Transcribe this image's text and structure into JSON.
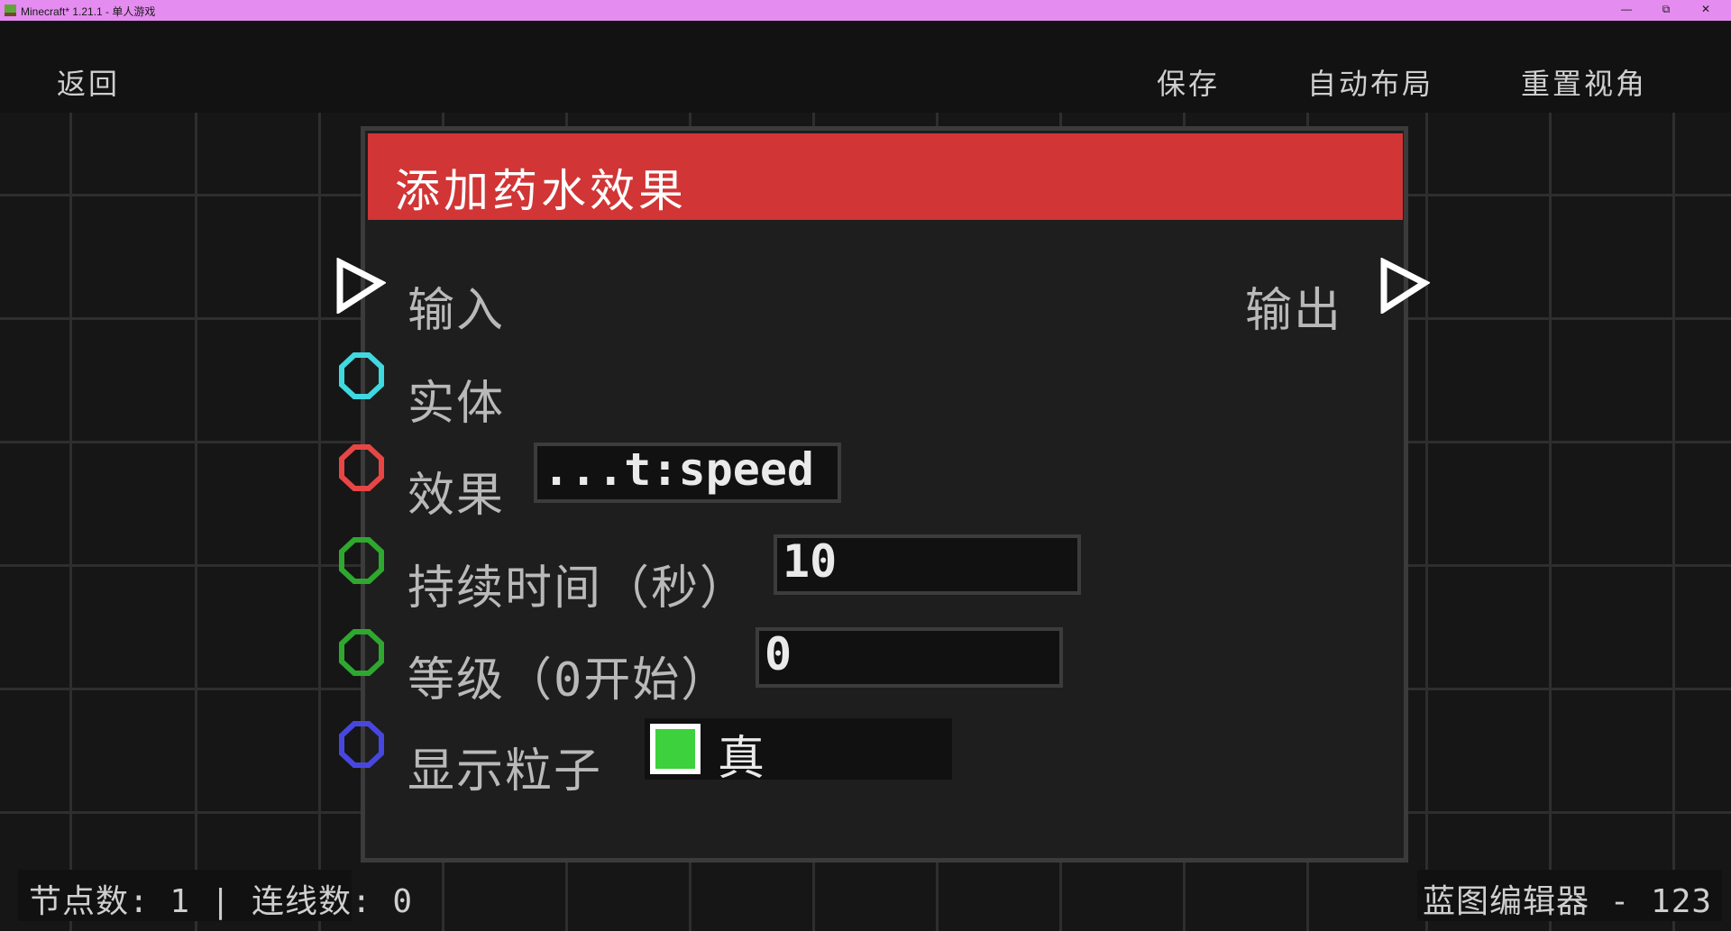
{
  "window": {
    "title": "Minecraft* 1.21.1 - 单人游戏",
    "minimize": "—",
    "maximize": "⧉",
    "close": "✕"
  },
  "menu": {
    "back": "返回",
    "save": "保存",
    "auto_layout": "自动布局",
    "reset_view": "重置视角"
  },
  "node": {
    "title": "添加药水效果",
    "header_color": "#d13535",
    "input_label": "输入",
    "output_label": "输出",
    "pins": [
      {
        "label": "实体",
        "color": "#3fd9e0"
      },
      {
        "label": "效果",
        "color": "#e84545",
        "value": "...t:speed"
      },
      {
        "label": "持续时间（秒）",
        "color": "#2ea82e",
        "value": "10"
      },
      {
        "label": "等级（0开始）",
        "color": "#2ea82e",
        "value": "0"
      },
      {
        "label": "显示粒子",
        "color": "#4747e0",
        "value": "真",
        "checked": true
      }
    ]
  },
  "status": {
    "left": "节点数: 1 | 连线数: 0",
    "right": "蓝图编辑器 - 123"
  }
}
